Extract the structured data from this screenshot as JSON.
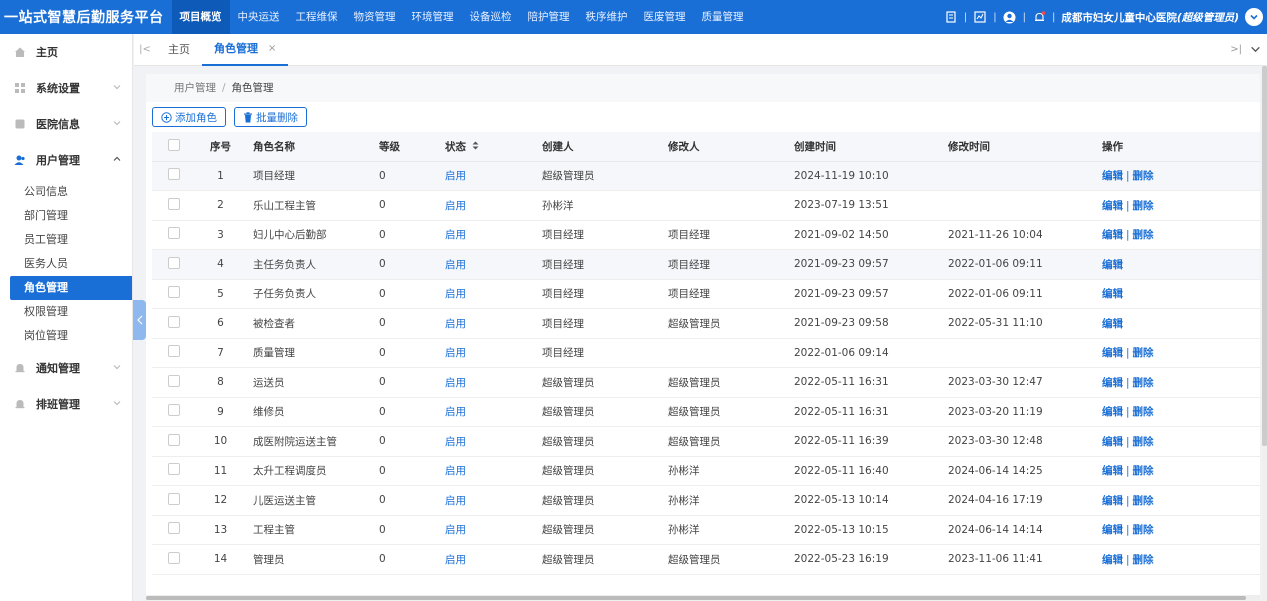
{
  "app": {
    "brand": "一站式智慧后勤服务平台",
    "nav": [
      "项目概览",
      "中央运送",
      "工程维保",
      "物资管理",
      "环境管理",
      "设备巡检",
      "陪护管理",
      "秩序维护",
      "医废管理",
      "质量管理"
    ],
    "hospital": "成都市妇女儿童中心医院",
    "role": "(超级管理员)"
  },
  "sidebar": {
    "home": "主页",
    "system": "系统设置",
    "hospital_info": "医院信息",
    "user_mgmt": "用户管理",
    "sub": [
      "公司信息",
      "部门管理",
      "员工管理",
      "医务人员",
      "角色管理",
      "权限管理",
      "岗位管理"
    ],
    "notice": "通知管理",
    "shift": "排班管理"
  },
  "tabs": {
    "home": "主页",
    "current": "角色管理",
    "close": "×"
  },
  "breadcrumb": {
    "parent": "用户管理",
    "current": "角色管理"
  },
  "actions": {
    "add": "添加角色",
    "batch_delete": "批量删除"
  },
  "table": {
    "headers": [
      "序号",
      "角色名称",
      "等级",
      "状态",
      "创建人",
      "修改人",
      "创建时间",
      "修改时间",
      "操作"
    ],
    "edit": "编辑",
    "delete": "删除",
    "op_sep": "|",
    "rows": [
      {
        "no": "1",
        "name": "项目经理",
        "level": "0",
        "status": "启用",
        "creator": "超级管理员",
        "modifier": "",
        "created": "2024-11-19 10:10",
        "modified": "",
        "del": true
      },
      {
        "no": "2",
        "name": "乐山工程主管",
        "level": "0",
        "status": "启用",
        "creator": "孙彬洋",
        "modifier": "",
        "created": "2023-07-19 13:51",
        "modified": "",
        "del": true
      },
      {
        "no": "3",
        "name": "妇儿中心后勤部",
        "level": "0",
        "status": "启用",
        "creator": "项目经理",
        "modifier": "项目经理",
        "created": "2021-09-02 14:50",
        "modified": "2021-11-26 10:04",
        "del": true
      },
      {
        "no": "4",
        "name": "主任务负责人",
        "level": "0",
        "status": "启用",
        "creator": "项目经理",
        "modifier": "项目经理",
        "created": "2021-09-23 09:57",
        "modified": "2022-01-06 09:11",
        "del": false
      },
      {
        "no": "5",
        "name": "子任务负责人",
        "level": "0",
        "status": "启用",
        "creator": "项目经理",
        "modifier": "项目经理",
        "created": "2021-09-23 09:57",
        "modified": "2022-01-06 09:11",
        "del": false
      },
      {
        "no": "6",
        "name": "被检查者",
        "level": "0",
        "status": "启用",
        "creator": "项目经理",
        "modifier": "超级管理员",
        "created": "2021-09-23 09:58",
        "modified": "2022-05-31 11:10",
        "del": false
      },
      {
        "no": "7",
        "name": "质量管理",
        "level": "0",
        "status": "启用",
        "creator": "项目经理",
        "modifier": "",
        "created": "2022-01-06 09:14",
        "modified": "",
        "del": true
      },
      {
        "no": "8",
        "name": "运送员",
        "level": "0",
        "status": "启用",
        "creator": "超级管理员",
        "modifier": "超级管理员",
        "created": "2022-05-11 16:31",
        "modified": "2023-03-30 12:47",
        "del": true
      },
      {
        "no": "9",
        "name": "维修员",
        "level": "0",
        "status": "启用",
        "creator": "超级管理员",
        "modifier": "超级管理员",
        "created": "2022-05-11 16:31",
        "modified": "2023-03-20 11:19",
        "del": true
      },
      {
        "no": "10",
        "name": "成医附院运送主管",
        "level": "0",
        "status": "启用",
        "creator": "超级管理员",
        "modifier": "超级管理员",
        "created": "2022-05-11 16:39",
        "modified": "2023-03-30 12:48",
        "del": true
      },
      {
        "no": "11",
        "name": "太升工程调度员",
        "level": "0",
        "status": "启用",
        "creator": "超级管理员",
        "modifier": "孙彬洋",
        "created": "2022-05-11 16:40",
        "modified": "2024-06-14 14:25",
        "del": true
      },
      {
        "no": "12",
        "name": "儿医运送主管",
        "level": "0",
        "status": "启用",
        "creator": "超级管理员",
        "modifier": "孙彬洋",
        "created": "2022-05-13 10:14",
        "modified": "2024-04-16 17:19",
        "del": true
      },
      {
        "no": "13",
        "name": "工程主管",
        "level": "0",
        "status": "启用",
        "creator": "超级管理员",
        "modifier": "孙彬洋",
        "created": "2022-05-13 10:15",
        "modified": "2024-06-14 14:14",
        "del": true
      },
      {
        "no": "14",
        "name": "管理员",
        "level": "0",
        "status": "启用",
        "creator": "超级管理员",
        "modifier": "超级管理员",
        "created": "2022-05-23 16:19",
        "modified": "2023-11-06 11:41",
        "del": true
      }
    ]
  }
}
